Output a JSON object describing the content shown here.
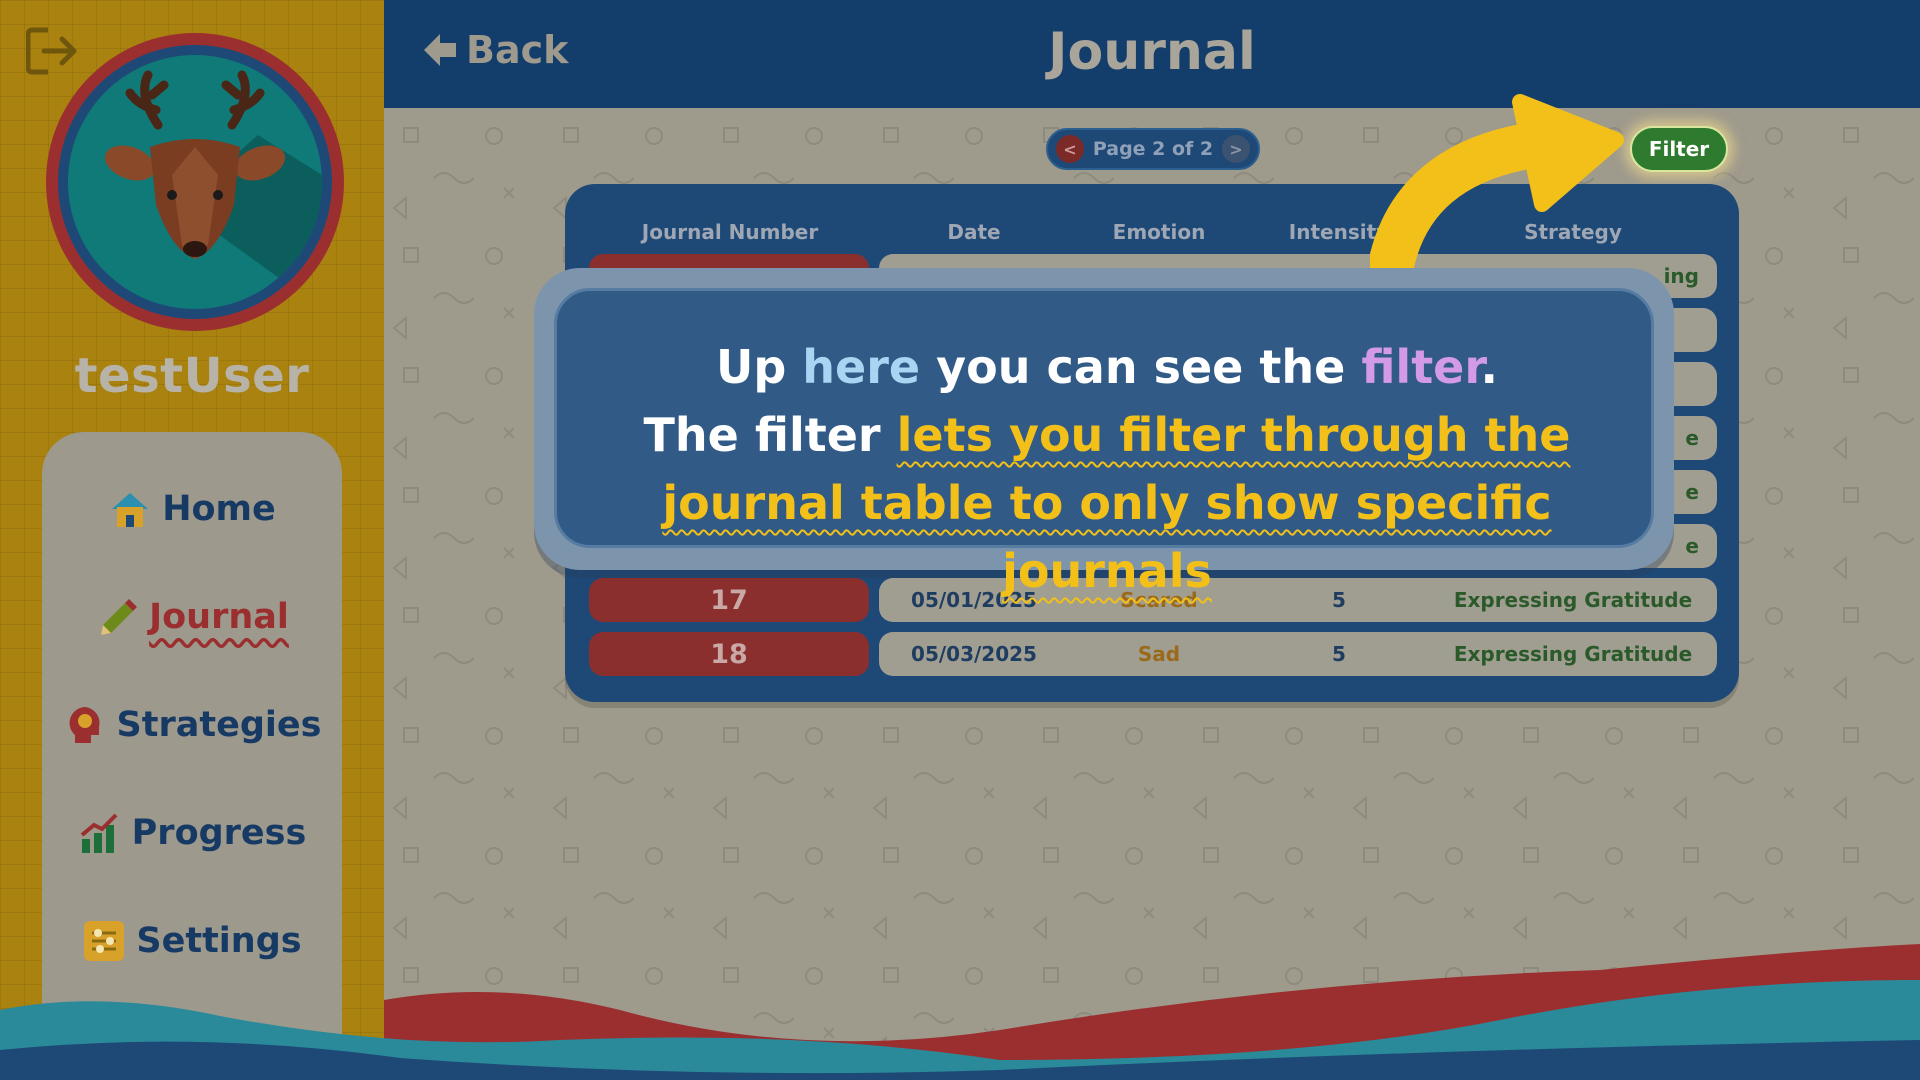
{
  "app": {
    "username": "testUser"
  },
  "sidebar": {
    "items": [
      {
        "label": "Home",
        "icon": "home-icon"
      },
      {
        "label": "Journal",
        "icon": "pencil-icon",
        "active": true
      },
      {
        "label": "Strategies",
        "icon": "head-icon"
      },
      {
        "label": "Progress",
        "icon": "chart-icon"
      },
      {
        "label": "Settings",
        "icon": "sliders-icon"
      }
    ]
  },
  "header": {
    "back_label": "Back",
    "title": "Journal"
  },
  "pager": {
    "text": "Page 2 of 2",
    "prev": "<",
    "next": ">"
  },
  "filter": {
    "label": "Filter"
  },
  "table": {
    "headers": [
      "Journal Number",
      "Date",
      "Emotion",
      "Intensity",
      "Strategy"
    ],
    "rows": [
      {
        "num": "17",
        "date": "05/01/2025",
        "emotion": "Scared",
        "intensity": "5",
        "strategy": "Expressing Gratitude"
      },
      {
        "num": "18",
        "date": "05/03/2025",
        "emotion": "Sad",
        "intensity": "5",
        "strategy": "Expressing Gratitude"
      }
    ],
    "partial_strategy_fragments": [
      "ing",
      "e",
      "e",
      "e"
    ]
  },
  "tooltip": {
    "line1_a": "Up ",
    "line1_here": "here",
    "line1_b": " you can see the ",
    "line1_filter": "filter",
    "line1_c": ".",
    "line2_a": "The filter ",
    "line2_highlight": "lets you filter through the journal table to only show specific journals"
  },
  "colors": {
    "header": "#133d6b",
    "sidebar": "#a9820f",
    "accent_red": "#9b2f30",
    "filter_green": "#2e7a2e",
    "arrow_yellow": "#f2c019"
  }
}
